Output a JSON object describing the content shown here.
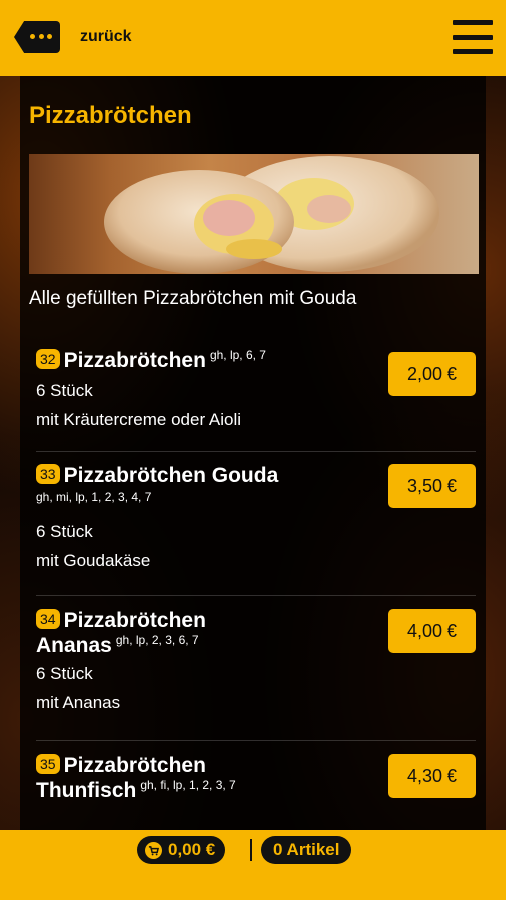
{
  "header": {
    "back_label": "zurück"
  },
  "category": {
    "title": "Pizzabrötchen",
    "description": "Alle gefüllten Pizzabrötchen mit Gouda"
  },
  "items": [
    {
      "number": "32",
      "name": "Pizzabrötchen",
      "allergens": "gh, lp, 6, 7",
      "lines": [
        "6 Stück",
        "mit Kräutercreme oder Aioli"
      ],
      "price": "2,00 €"
    },
    {
      "number": "33",
      "name": "Pizzabrötchen Gouda",
      "allergens": "gh, mi, lp, 1, 2, 3, 4, 7",
      "lines": [
        "6 Stück",
        "mit Goudakäse"
      ],
      "price": "3,50 €"
    },
    {
      "number": "34",
      "name_line1": "Pizzabrötchen",
      "name_line2": "Ananas",
      "allergens": "gh, lp, 2, 3, 6, 7",
      "lines": [
        "6 Stück",
        "mit Ananas"
      ],
      "price": "4,00 €"
    },
    {
      "number": "35",
      "name_line1": "Pizzabrötchen",
      "name_line2": "Thunfisch",
      "allergens": "gh, fi, lp, 1, 2, 3, 7",
      "lines": [],
      "price": "4,30 €"
    }
  ],
  "footer": {
    "cart_total": "0,00 €",
    "articles_label": "0 Artikel"
  },
  "colors": {
    "accent": "#f7b500",
    "panel": "#000000",
    "text": "#ffffff"
  },
  "icons": [
    "back-dots-icon",
    "menu-icon",
    "cart-icon"
  ]
}
